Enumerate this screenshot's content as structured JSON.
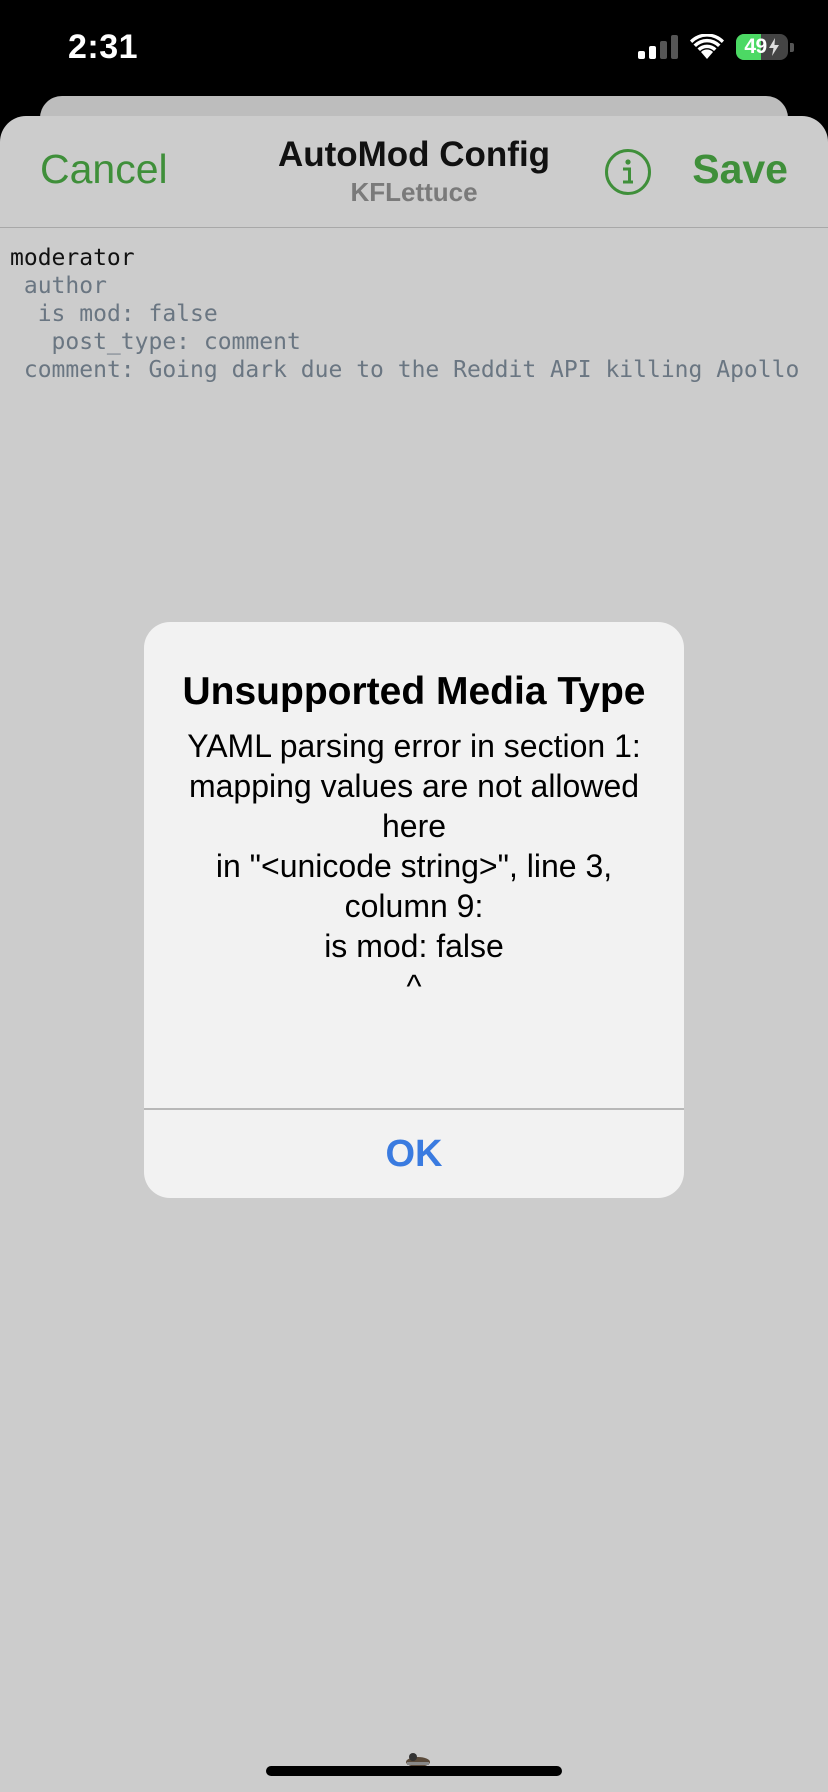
{
  "status_bar": {
    "time": "2:31",
    "battery": "49",
    "battery_level_percent": 49,
    "icons": [
      "signal-icon",
      "wifi-icon",
      "battery-icon",
      "charging-bolt-icon"
    ]
  },
  "nav": {
    "cancel_label": "Cancel",
    "title": "AutoMod Config",
    "subtitle": "KFLettuce",
    "info_icon": "info-circle-icon",
    "save_label": "Save"
  },
  "editor": {
    "lines": [
      "moderator",
      " author",
      "  is mod: false",
      "   post_type: comment",
      " comment: Going dark due to the Reddit API killing Apollo"
    ]
  },
  "alert": {
    "title": "Unsupported Media Type",
    "message": "YAML parsing error in section 1: mapping values are not allowed here\n  in \"<unicode string>\", line 3, column 9:\n      is mod: false\n            ^",
    "ok_label": "OK"
  },
  "colors": {
    "accent_green": "#3f8f3a",
    "alert_button_blue": "#3a7be0",
    "sheet_background": "#cccccc",
    "editor_text": "#6a7682"
  }
}
